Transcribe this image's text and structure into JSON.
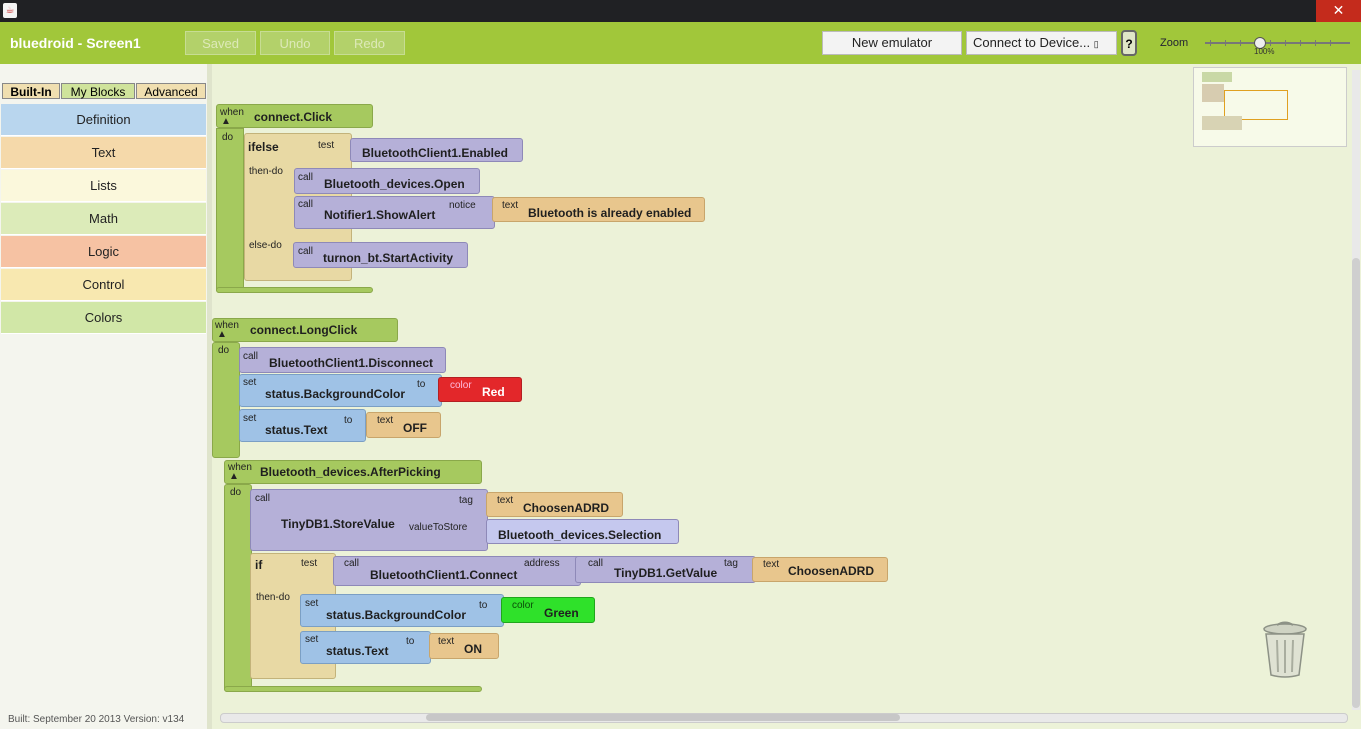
{
  "window": {
    "close": "✕"
  },
  "app": {
    "title": "bluedroid - Screen1"
  },
  "toolbar": {
    "saved": "Saved",
    "undo": "Undo",
    "redo": "Redo",
    "new_emulator": "New emulator",
    "connect": "Connect to Device...",
    "help": "?",
    "zoom": "Zoom",
    "zoom_pct": "100%"
  },
  "tabs": [
    "Built-In",
    "My Blocks",
    "Advanced"
  ],
  "drawers": [
    "Definition",
    "Text",
    "Lists",
    "Math",
    "Logic",
    "Control",
    "Colors"
  ],
  "colors": {
    "Definition": "#b9d6ee",
    "Text": "#f5d9aa",
    "Lists": "#fbf8dc",
    "Math": "#dcebb9",
    "Logic": "#f6c2a3",
    "Control": "#f8e8b0",
    "Colors": "#d1e7a7"
  },
  "built": "Built: September 20 2013 Version: v134",
  "b1": {
    "when": "when",
    "event": "connect.Click",
    "do": "do",
    "ifelse": "ifelse",
    "test": "test",
    "enabled": "BluetoothClient1.Enabled",
    "then_do": "then-do",
    "call": "call",
    "open": "Bluetooth_devices.Open",
    "alert": "Notifier1.ShowAlert",
    "notice": "notice",
    "text": "text",
    "msg": "Bluetooth is already enabled",
    "else_do": "else-do",
    "start": "turnon_bt.StartActivity"
  },
  "b2": {
    "when": "when",
    "event": "connect.LongClick",
    "do": "do",
    "call": "call",
    "disconnect": "BluetoothClient1.Disconnect",
    "set": "set",
    "bg": "status.BackgroundColor",
    "to": "to",
    "color": "color",
    "red": "Red",
    "status_text": "status.Text",
    "text": "text",
    "off": "OFF"
  },
  "b3": {
    "when": "when",
    "event": "Bluetooth_devices.AfterPicking",
    "do": "do",
    "call": "call",
    "store": "TinyDB1.StoreValue",
    "tag": "tag",
    "value_to_store": "valueToStore",
    "text": "text",
    "chosen": "ChoosenADRD",
    "selection": "Bluetooth_devices.Selection",
    "if": "if",
    "test": "test",
    "connect": "BluetoothClient1.Connect",
    "address": "address",
    "getvalue": "TinyDB1.GetValue",
    "then_do": "then-do",
    "set": "set",
    "bg": "status.BackgroundColor",
    "to": "to",
    "color": "color",
    "green": "Green",
    "status_text": "status.Text",
    "on": "ON"
  }
}
